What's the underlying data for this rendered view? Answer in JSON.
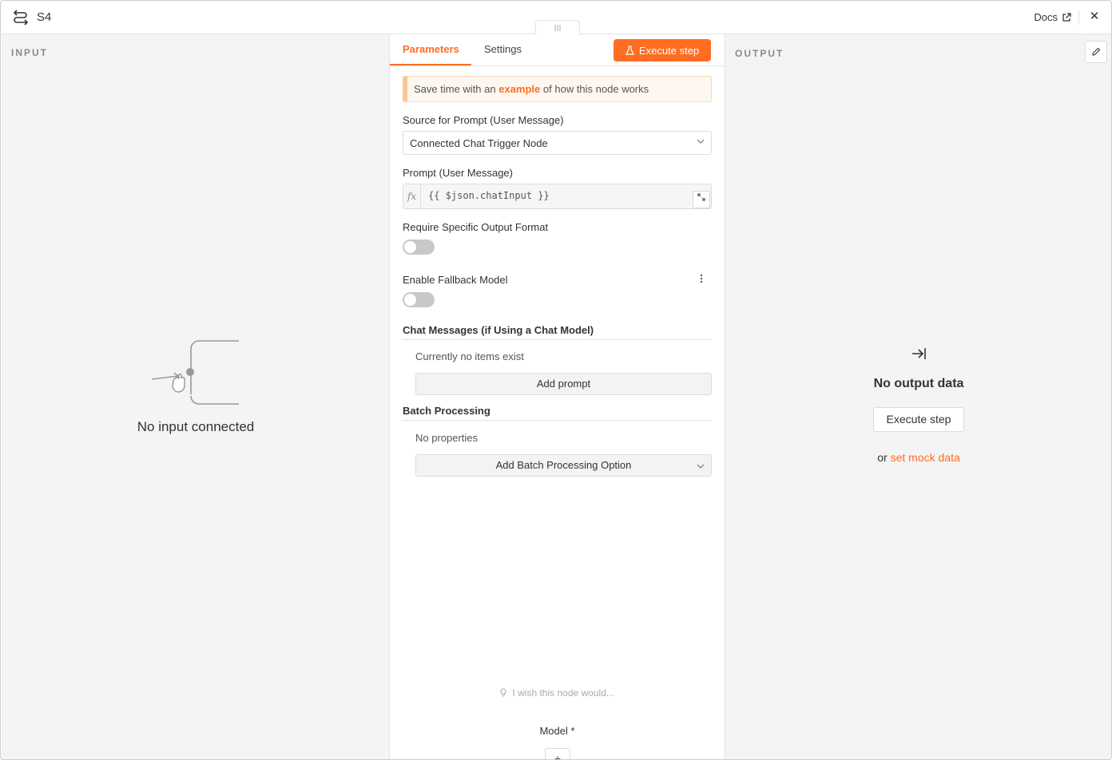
{
  "header": {
    "title": "S4",
    "docs_label": "Docs",
    "close_glyph": "✕"
  },
  "input_panel": {
    "label": "INPUT",
    "empty_text": "No input connected"
  },
  "tabs": [
    {
      "label": "Parameters",
      "active": true
    },
    {
      "label": "Settings",
      "active": false
    }
  ],
  "execute_label": "Execute step",
  "notice": {
    "before": "Save time with an",
    "link": "example",
    "after": "of how this node works"
  },
  "fields": {
    "prompt_source_label": "Source for Prompt (User Message)",
    "prompt_source_value": "Connected Chat Trigger Node",
    "prompt_label": "Prompt (User Message)",
    "prompt_fx": "fx",
    "prompt_value": "{{ $json.chatInput }}",
    "output_format_label": "Require Specific Output Format",
    "fallback_label": "Enable Fallback Model"
  },
  "toggles": {
    "output_format": false,
    "fallback_model": false
  },
  "chat_messages": {
    "title": "Chat Messages (if Using a Chat Model)",
    "empty_text": "Currently no items exist",
    "add_label": "Add prompt"
  },
  "batch": {
    "title": "Batch Processing",
    "empty_text": "No properties",
    "add_label": "Add Batch Processing Option"
  },
  "wish_text": "I wish this node would...",
  "model_label": "Model *",
  "plus_glyph": "+",
  "output_panel": {
    "label": "OUTPUT",
    "empty_title": "No output data",
    "execute_label": "Execute step",
    "or_text": "or",
    "mock_link": "set mock data"
  },
  "colors": {
    "accent": "#ff6d23",
    "panel_bg": "#f4f4f4"
  }
}
